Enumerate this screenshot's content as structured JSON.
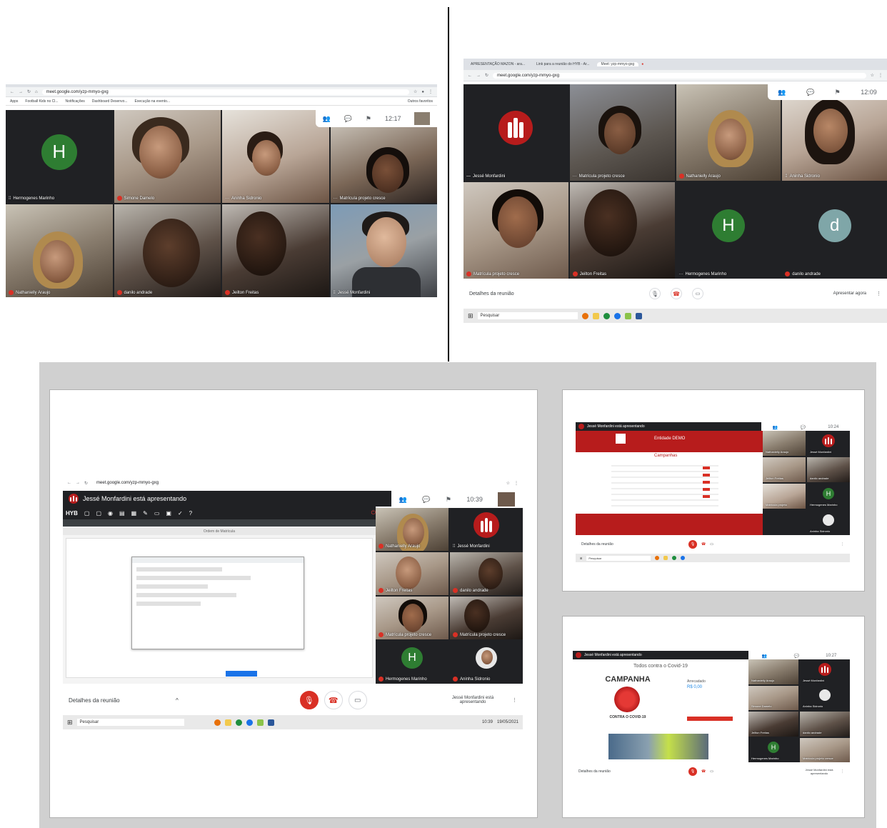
{
  "panel_tl": {
    "url": "meet.google.com/yzp-mmyo-gxg",
    "bookmarks": [
      "Apps",
      "Football Kids no Cl...",
      "Notificações",
      "Dashboard Desenvo...",
      "Execução na evento..."
    ],
    "bookmarks_right": "Outros favoritos",
    "clock": "12:17",
    "tiles": [
      {
        "name": "Hermogenes Marinho",
        "avatar": "H"
      },
      {
        "name": "Simone Damelo"
      },
      {
        "name": "Aninha Sidronio"
      },
      {
        "name": "Matrícula projeto cresce"
      },
      {
        "name": "Nathanielly Araujo"
      },
      {
        "name": "danilo andrade"
      },
      {
        "name": "Jeilton Freitas"
      },
      {
        "name": "Jessé Monfardini"
      }
    ]
  },
  "panel_tr": {
    "tabs": [
      "APRESENTAÇÃO MAZON - ara...",
      "Link para a reunião do HYB - Ar...",
      "Meet: yzp-mmyo-gxg"
    ],
    "url": "meet.google.com/yzp-mmyo-gxg",
    "clock": "12:09",
    "tiles": [
      {
        "name": "Jessé Monfardini"
      },
      {
        "name": "Matrícula projeto cresce"
      },
      {
        "name": "Nathanielly Araujo"
      },
      {
        "name": "Aninha Sidronio"
      },
      {
        "name": "Matrícula projeto cresce"
      },
      {
        "name": "Jeilton Freitas"
      },
      {
        "name": "Hermogenes Marinho",
        "avatar": "H"
      },
      {
        "name": "danilo andrade",
        "avatar": "d"
      }
    ],
    "details_label": "Detalhes da reunião",
    "present_label": "Apresentar agora",
    "search_label": "Pesquisar"
  },
  "panel_main": {
    "url": "meet.google.com/yzp-mmyo-gxg",
    "presenting_banner": "Jessé Monfardini está apresentando",
    "clock": "10:39",
    "app_logo": "HYB",
    "form_title": "Ordem de Matrícula",
    "tiles": [
      {
        "name": "Nathanielly Araujo"
      },
      {
        "name": "Jessé Monfardini"
      },
      {
        "name": "Jeilton Freitas"
      },
      {
        "name": "danilo andrade"
      },
      {
        "name": "Matrícula projeto cresce"
      },
      {
        "name": "Matrícula projeto cresce"
      },
      {
        "name": "Hermogenes Marinho",
        "avatar": "H"
      },
      {
        "name": "Aninha Sidronio"
      }
    ],
    "details_label": "Detalhes da reunião",
    "presenting_note": "Jessé Monfardini está apresentando",
    "search_label": "Pesquisar",
    "taskbar_time": "10:39",
    "taskbar_date": "19/05/2021"
  },
  "panel_sr1": {
    "presenting_banner": "Jessé Monfardini está apresentando",
    "clock": "10:24",
    "site_title": "Entidade DEMO",
    "section_title": "Campanhas",
    "tiles": [
      {
        "name": "Nathanielly Araujo"
      },
      {
        "name": "Jessé Monfardini"
      },
      {
        "name": "Jeilton Freitas"
      },
      {
        "name": "danilo andrade"
      },
      {
        "name": "Matrícula projeto"
      },
      {
        "name": "Hermogenes Marinho",
        "avatar": "H"
      },
      {
        "name": "Aninha Sidronio"
      }
    ],
    "details_label": "Detalhes da reunião",
    "search_label": "Pesquisar"
  },
  "panel_sr2": {
    "presenting_banner": "Jessé Monfardini está apresentando",
    "clock": "10:27",
    "heading": "Todos contra o Covid-19",
    "campaign_title": "CAMPANHA",
    "campaign_subtitle": "CONTRA O COVID-19",
    "raised_label": "Arrecadado",
    "raised_value": "R$ 0,00",
    "tiles": [
      {
        "name": "Nathanielly Araujo"
      },
      {
        "name": "Jessé Monfardini"
      },
      {
        "name": "Simone Damelo"
      },
      {
        "name": "Aninha Sidronio"
      },
      {
        "name": "Jeilton Freitas"
      },
      {
        "name": "danilo andrade"
      },
      {
        "name": "Hermogenes Marinho",
        "avatar": "H"
      },
      {
        "name": "Matrícula projeto cresce"
      }
    ],
    "details_label": "Detalhes da reunião",
    "presenting_note": "Jessé Monfardini está apresentando"
  },
  "colors": {
    "meet_dark": "#202124",
    "avatar_green": "#2e7d32",
    "avatar_teal": "#7fa6a8",
    "brand_red": "#b71c1c",
    "end_call_red": "#d93025"
  }
}
